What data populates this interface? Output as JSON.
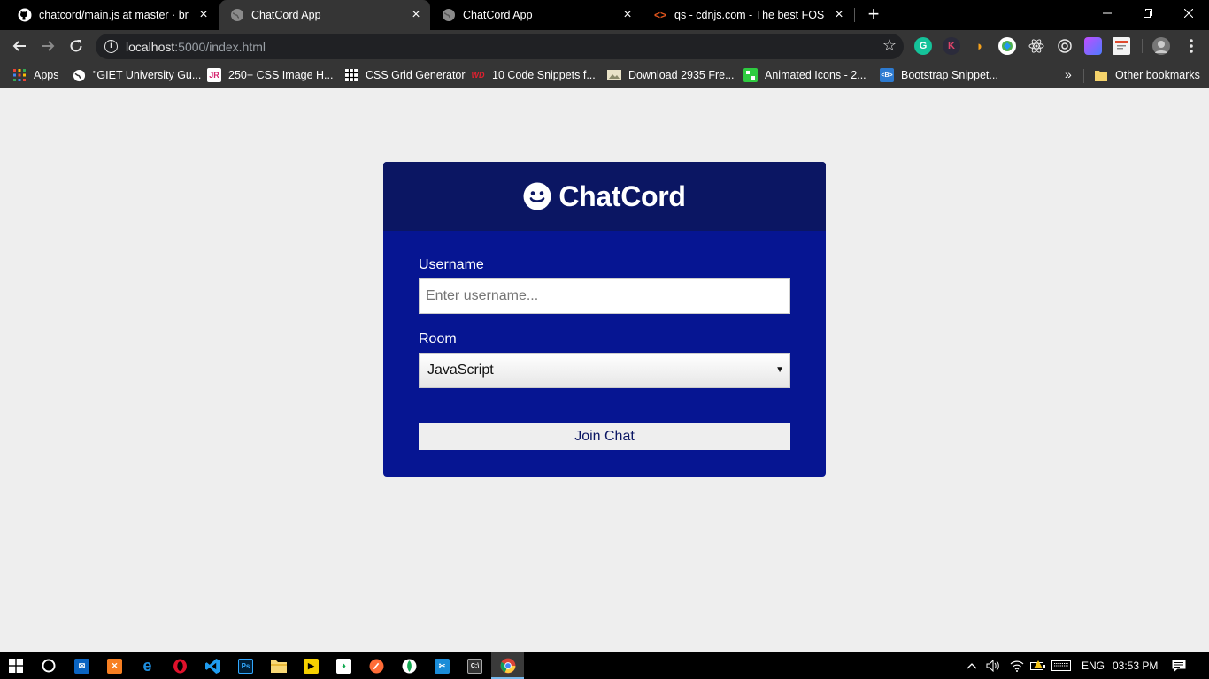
{
  "tabs": [
    {
      "title": "chatcord/main.js at master · brad",
      "icon": "github-icon",
      "active": false
    },
    {
      "title": "ChatCord App",
      "icon": "globe-icon",
      "active": true
    },
    {
      "title": "ChatCord App",
      "icon": "globe-icon",
      "active": false
    },
    {
      "title": "qs - cdnjs.com - The best FOSS C",
      "icon": "code-brackets-icon",
      "active": false
    }
  ],
  "toolbar": {
    "url_host": "localhost",
    "url_path": ":5000/index.html"
  },
  "bookmarks": {
    "items": [
      {
        "label": "Apps",
        "icon": "apps-grid-icon"
      },
      {
        "label": "\"GIET University Gu...",
        "icon": "globe-icon"
      },
      {
        "label": "250+ CSS Image H...",
        "icon": "jr-icon",
        "icon_text": "JR"
      },
      {
        "label": "CSS Grid Generator",
        "icon": "grid-icon"
      },
      {
        "label": "10 Code Snippets f...",
        "icon": "wd-icon",
        "icon_text": "WD"
      },
      {
        "label": "Download 2935 Fre...",
        "icon": "image-icon"
      },
      {
        "label": "Animated Icons - 2...",
        "icon": "animated-icons-icon"
      },
      {
        "label": "Bootstrap Snippet...",
        "icon": "bootstrap-icon",
        "icon_text": "<B>"
      }
    ],
    "more": "»",
    "other": "Other bookmarks"
  },
  "app": {
    "logo_text": "ChatCord",
    "username_label": "Username",
    "username_placeholder": "Enter username...",
    "room_label": "Room",
    "room_selected": "JavaScript",
    "join_button": "Join Chat",
    "colors": {
      "header": "#0b1663",
      "card": "#061592",
      "page_bg": "#eeeeee"
    }
  },
  "taskbar": {
    "language": "ENG",
    "time": "03:53 PM"
  }
}
